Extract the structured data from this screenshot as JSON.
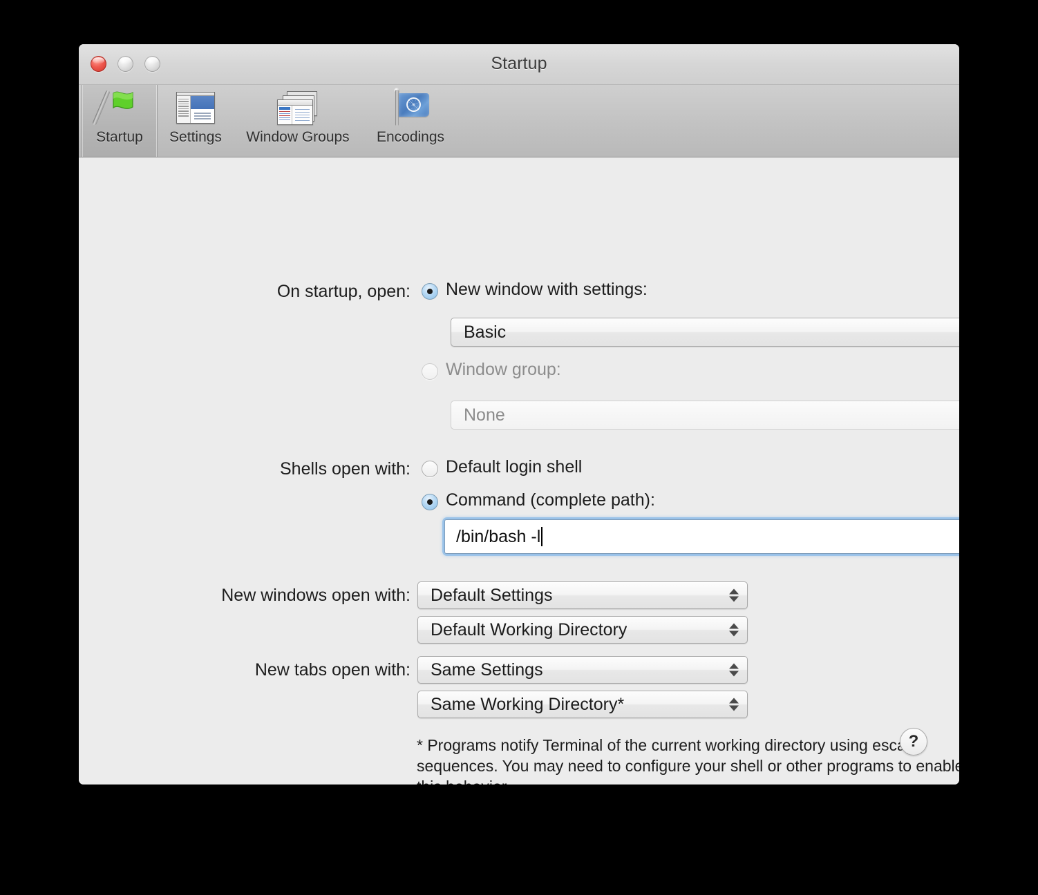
{
  "window": {
    "title": "Startup",
    "traffic_lights": {
      "close": "close-button",
      "minimize": "minimize-button",
      "zoom": "zoom-button"
    }
  },
  "toolbar": {
    "items": [
      {
        "label": "Startup",
        "icon": "green-flag-icon",
        "selected": true
      },
      {
        "label": "Settings",
        "icon": "settings-window-icon",
        "selected": false
      },
      {
        "label": "Window Groups",
        "icon": "window-groups-icon",
        "selected": false
      },
      {
        "label": "Encodings",
        "icon": "un-flag-icon",
        "selected": false
      }
    ]
  },
  "content": {
    "on_startup": {
      "label": "On startup, open:",
      "option_new_window": {
        "label": "New window with settings:",
        "selected": true
      },
      "settings_popup": {
        "value": "Basic",
        "enabled": true
      },
      "option_window_group": {
        "label": "Window group:",
        "selected": false,
        "enabled": false
      },
      "window_group_popup": {
        "value": "None",
        "enabled": false
      }
    },
    "shells_open_with": {
      "label": "Shells open with:",
      "option_default_login_shell": {
        "label": "Default login shell",
        "selected": false
      },
      "option_command": {
        "label": "Command (complete path):",
        "selected": true
      },
      "command_field": {
        "value": "/bin/bash -l",
        "focused": true
      }
    },
    "new_windows_open_with": {
      "label": "New windows open with:",
      "settings_popup": {
        "value": "Default Settings"
      },
      "directory_popup": {
        "value": "Default Working Directory"
      }
    },
    "new_tabs_open_with": {
      "label": "New tabs open with:",
      "settings_popup": {
        "value": "Same Settings"
      },
      "directory_popup": {
        "value": "Same Working Directory*"
      }
    },
    "footnote": "* Programs notify Terminal of the current working directory using escape sequences. You may need to configure your shell or other programs to enable this behavior.",
    "help_button_label": "?"
  },
  "colors": {
    "content_background": "#ececec",
    "titlebar_top": "#e3e3e3",
    "toolbar_background": "#c2c2c2",
    "close_button": "#f05b51",
    "focus_ring": "#76b1e8",
    "flag_green": "#5fd02a",
    "un_flag_blue": "#4a7cbd",
    "settings_preview_blue": "#4573b8",
    "text": "#1d1d1d",
    "disabled_text": "#8c8c8c"
  }
}
